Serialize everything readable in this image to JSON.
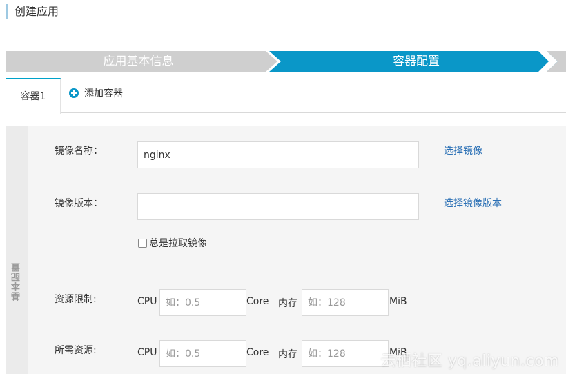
{
  "page": {
    "title": "创建应用"
  },
  "stepper": {
    "steps": [
      {
        "label": "应用基本信息",
        "state": "done"
      },
      {
        "label": "容器配置",
        "state": "active"
      }
    ],
    "colors": {
      "inactive": "#cfcfcf",
      "active": "#0a97c8"
    }
  },
  "tabs": {
    "active_tab": "容器1",
    "add_label": "添加容器"
  },
  "form": {
    "section_label": "基本配置",
    "image_name": {
      "label": "镜像名称：",
      "value": "nginx",
      "link": "选择镜像"
    },
    "image_version": {
      "label": "镜像版本：",
      "value": "",
      "link": "选择镜像版本"
    },
    "always_pull": {
      "label": "总是拉取镜像",
      "checked": false
    },
    "resource_limit": {
      "label": "资源限制:",
      "cpu_label": "CPU",
      "cpu_placeholder": "如：0.5",
      "cpu_unit": "Core",
      "mem_label": "内存",
      "mem_placeholder": "如：128",
      "mem_unit": "MiB"
    },
    "resource_request": {
      "label": "所需资源:",
      "cpu_label": "CPU",
      "cpu_placeholder": "如：0.5",
      "cpu_unit": "Core",
      "mem_label": "内存",
      "mem_placeholder": "如：128",
      "mem_unit": "MiB"
    }
  },
  "watermark": "云栖社区 yq.aliyun.com"
}
